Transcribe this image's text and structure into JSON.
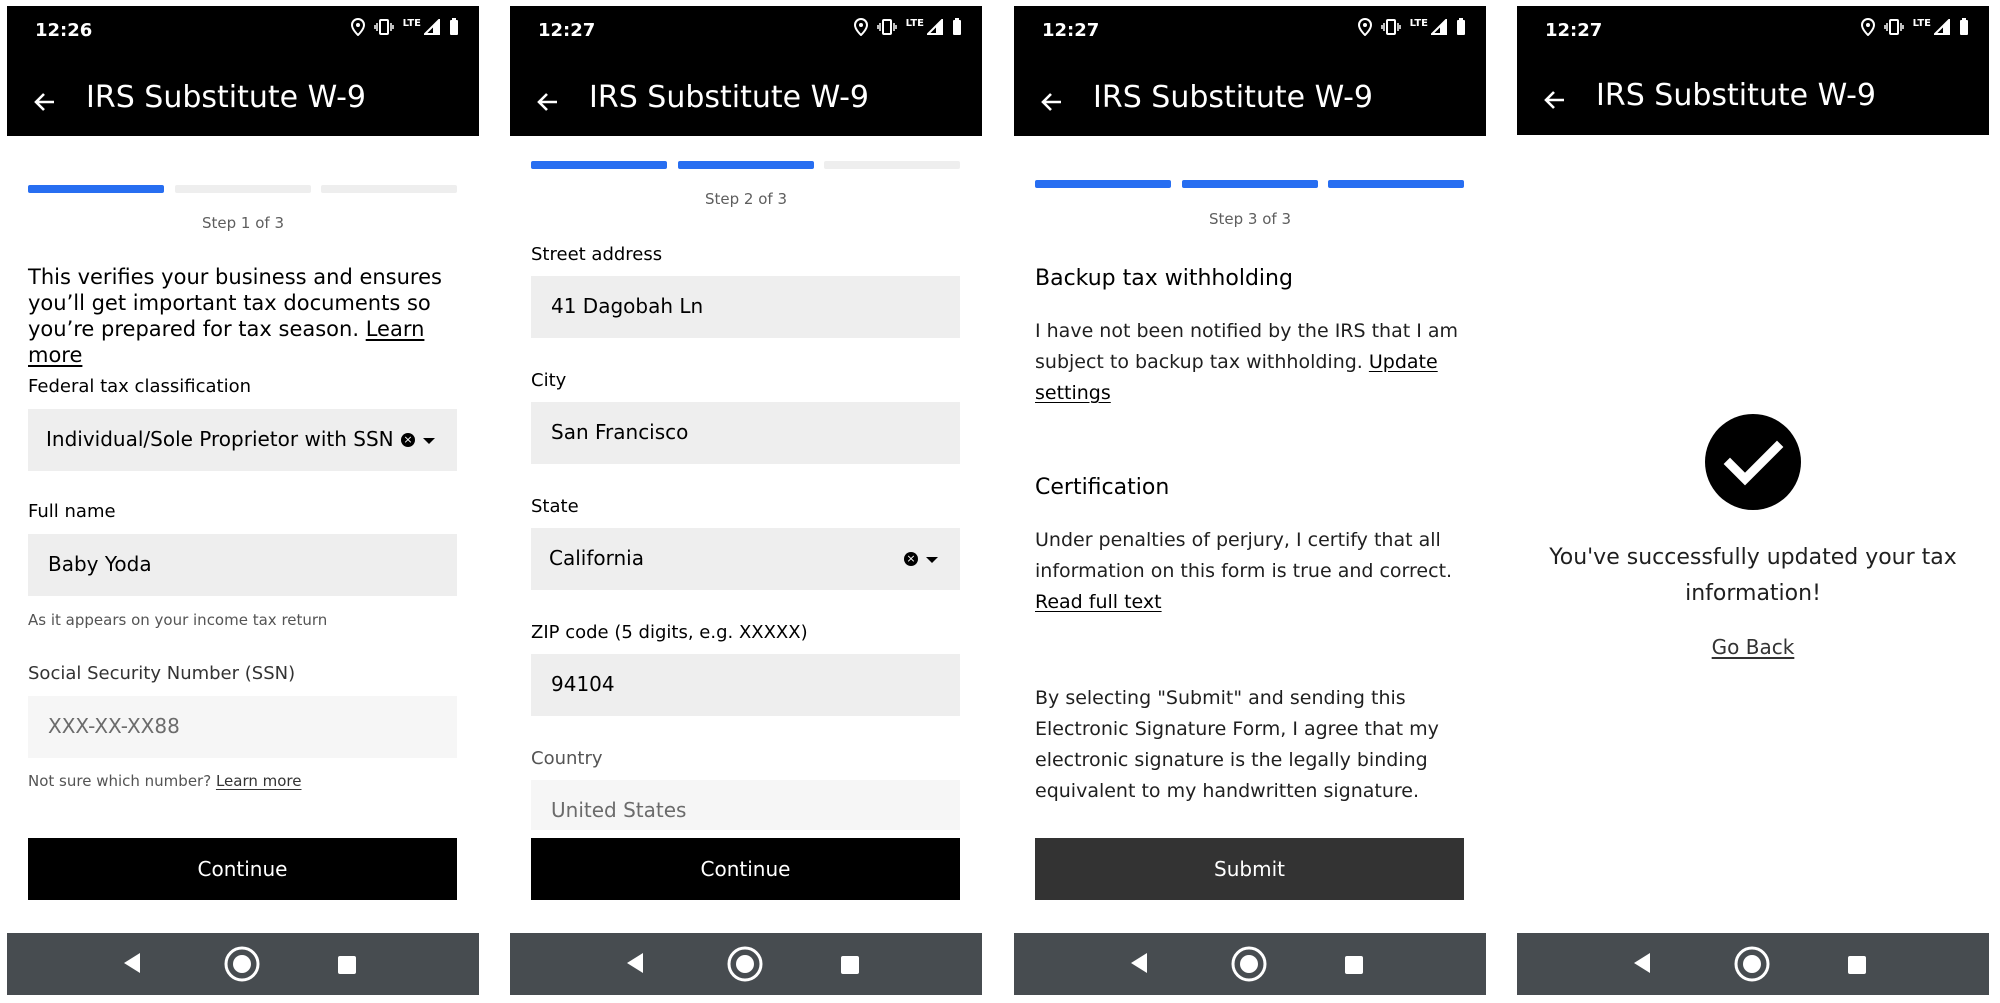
{
  "common": {
    "title": "IRS Substitute W-9",
    "lte": "LTE"
  },
  "screen1": {
    "time": "12:26",
    "step": "Step 1 of 3",
    "intro_l1": "This verifies your business and ensures",
    "intro_l2": "you’ll get important tax documents so",
    "intro_l3": "you’re prepared for tax season.",
    "learn_more": "Learn more",
    "tax_class_label": "Federal tax classification",
    "tax_class_value": "Individual/Sole Proprietor with SSN",
    "full_name_label": "Full name",
    "full_name_value": "Baby Yoda",
    "full_name_hint": "As it appears on your income tax return",
    "ssn_label": "Social Security Number (SSN)",
    "ssn_value": "XXX-XX-XX88",
    "ssn_hint": "Not sure which number?",
    "ssn_learn_more": "Learn more",
    "continue": "Continue"
  },
  "screen2": {
    "time": "12:27",
    "step": "Step 2 of 3",
    "street_label": "Street address",
    "street_value": "41 Dagobah Ln",
    "city_label": "City",
    "city_value": "San Francisco",
    "state_label": "State",
    "state_value": "California",
    "zip_label": "ZIP code (5 digits, e.g. XXXXX)",
    "zip_value": "94104",
    "country_label": "Country",
    "country_value": "United States",
    "continue": "Continue"
  },
  "screen3": {
    "time": "12:27",
    "step": "Step 3 of 3",
    "backup_heading": "Backup tax withholding",
    "backup_l1": "I have not been notified by the IRS that I am",
    "backup_l2": "subject to backup tax withholding.",
    "update_l1": "Update",
    "update_l2": "settings",
    "cert_heading": "Certification",
    "cert_l1": "Under penalties of perjury, I certify that all",
    "cert_l2": "information on this form is true and correct.",
    "read_full": "Read full text",
    "esig_l1": "By selecting \"Submit\" and sending this",
    "esig_l2": "Electronic Signature Form, I agree that my",
    "esig_l3": "electronic signature is the legally binding",
    "esig_l4": "equivalent to my handwritten signature.",
    "submit": "Submit"
  },
  "screen4": {
    "time": "12:27",
    "success_l1": "You've successfully updated your tax",
    "success_l2": "information!",
    "go_back": "Go Back"
  },
  "colors": {
    "accent": "#276ef1",
    "topbar": "#000000",
    "navbar": "#474c50",
    "field": "#eeeeee",
    "submit": "#333333"
  }
}
